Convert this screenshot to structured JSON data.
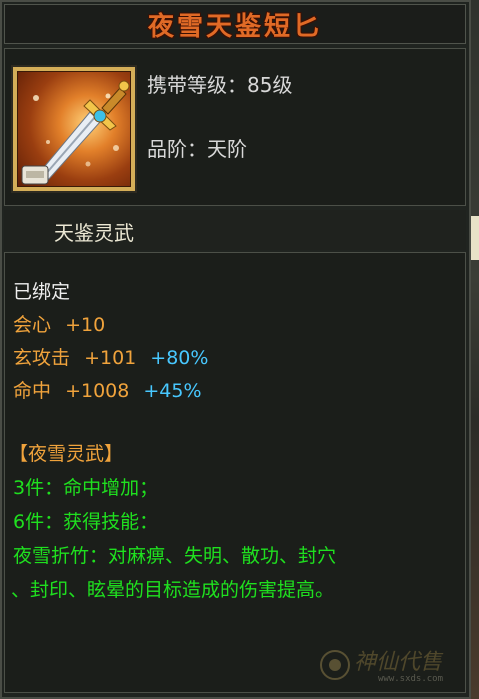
{
  "item": {
    "name": "夜雪天鉴短匕",
    "carry_level": "携带等级：85级",
    "grade": "品阶：天阶",
    "lingwu": "天鉴灵武"
  },
  "bound_status": "已绑定",
  "stats": [
    {
      "name": "会心",
      "base": "+10",
      "bonus": ""
    },
    {
      "name": "玄攻击",
      "base": "+101",
      "bonus": "+80%"
    },
    {
      "name": "命中",
      "base": "+1008",
      "bonus": "+45%"
    }
  ],
  "set": {
    "title": "【夜雪灵武】",
    "bonus_3": "3件：命中增加；",
    "bonus_6": "6件：获得技能：",
    "skill_line1": "夜雪折竹：对麻痹、失明、散功、封穴",
    "skill_line2": "、封印、眩晕的目标造成的伤害提高。"
  },
  "watermark": {
    "text": "神仙代售",
    "url": "www.sxds.com"
  },
  "colors": {
    "title": "#e06a26",
    "stat_name": "#f0a33c",
    "bonus": "#48c8ff",
    "set_text": "#1fe01f"
  },
  "icons": {
    "item_icon": "dagger-icon",
    "watermark_icon": "sxds-logo-icon"
  }
}
